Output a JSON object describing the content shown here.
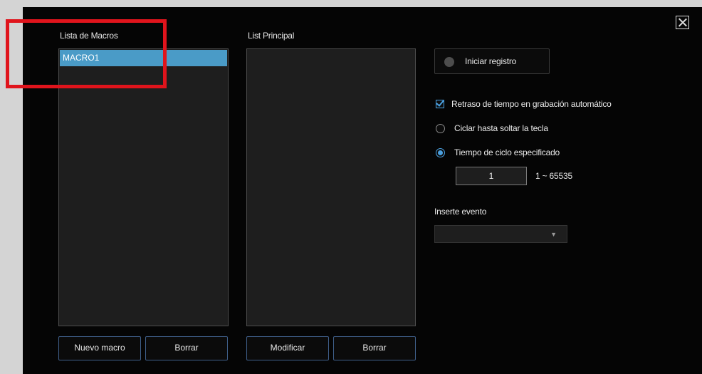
{
  "macro_list": {
    "title": "Lista de Macros",
    "items": [
      "MACRO1"
    ],
    "new_button": "Nuevo macro",
    "delete_button": "Borrar"
  },
  "main_list": {
    "title": "List Principal",
    "modify_button": "Modificar",
    "delete_button": "Borrar"
  },
  "recording": {
    "start_label": "Iniciar registro"
  },
  "options": {
    "auto_delay_label": "Retraso de tiempo en grabación automático",
    "auto_delay_checked": true,
    "cycle_until_release_label": "Ciclar hasta soltar la tecla",
    "cycle_specified_label": "Tiempo de ciclo especificado",
    "selected_option": "cycle_specified",
    "cycle_count": "1",
    "cycle_range": "1 ~ 65535"
  },
  "insert_event": {
    "label": "Inserte evento",
    "selected": ""
  },
  "colors": {
    "selection": "#4a9bc7",
    "accent": "#4aa0e0",
    "highlight_box": "#e0141c"
  }
}
